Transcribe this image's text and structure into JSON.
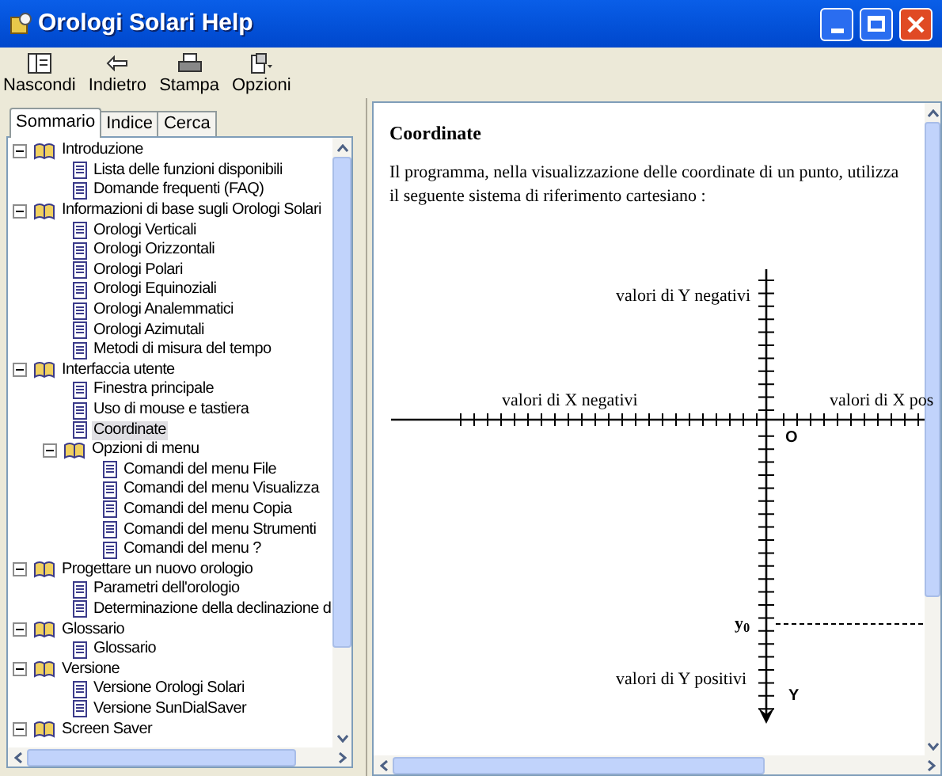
{
  "window": {
    "title": "Orologi Solari Help"
  },
  "toolbar": [
    {
      "label": "Nascondi",
      "kind": "hide"
    },
    {
      "label": "Indietro",
      "kind": "back"
    },
    {
      "label": "Stampa",
      "kind": "print"
    },
    {
      "label": "Opzioni",
      "kind": "options"
    }
  ],
  "tabs": [
    {
      "label": "Sommario",
      "selected": true
    },
    {
      "label": "Indice",
      "selected": false
    },
    {
      "label": "Cerca",
      "selected": false
    }
  ],
  "tree": [
    {
      "label": "Introduzione",
      "kind": "book",
      "expanded": true,
      "selected": false,
      "children": [
        {
          "label": "Lista delle funzioni disponibili",
          "kind": "page",
          "selected": false
        },
        {
          "label": "Domande frequenti (FAQ)",
          "kind": "page",
          "selected": false
        }
      ]
    },
    {
      "label": "Informazioni di base sugli Orologi Solari",
      "kind": "book",
      "expanded": true,
      "selected": false,
      "children": [
        {
          "label": "Orologi Verticali",
          "kind": "page",
          "selected": false
        },
        {
          "label": "Orologi Orizzontali",
          "kind": "page",
          "selected": false
        },
        {
          "label": "Orologi Polari",
          "kind": "page",
          "selected": false
        },
        {
          "label": "Orologi Equinoziali",
          "kind": "page",
          "selected": false
        },
        {
          "label": "Orologi Analemmatici",
          "kind": "page",
          "selected": false
        },
        {
          "label": "Orologi Azimutali",
          "kind": "page",
          "selected": false
        },
        {
          "label": "Metodi di misura del tempo",
          "kind": "page",
          "selected": false
        }
      ]
    },
    {
      "label": "Interfaccia utente",
      "kind": "book",
      "expanded": true,
      "selected": false,
      "children": [
        {
          "label": "Finestra principale",
          "kind": "page",
          "selected": false
        },
        {
          "label": "Uso di mouse e tastiera",
          "kind": "page",
          "selected": false
        },
        {
          "label": "Coordinate",
          "kind": "page",
          "selected": true
        },
        {
          "label": "Opzioni di menu",
          "kind": "book",
          "expanded": true,
          "selected": false,
          "children": [
            {
              "label": "Comandi del menu File",
              "kind": "page",
              "selected": false
            },
            {
              "label": "Comandi del menu Visualizza",
              "kind": "page",
              "selected": false
            },
            {
              "label": "Comandi del menu Copia",
              "kind": "page",
              "selected": false
            },
            {
              "label": "Comandi del menu Strumenti",
              "kind": "page",
              "selected": false
            },
            {
              "label": "Comandi del menu ?",
              "kind": "page",
              "selected": false
            }
          ]
        }
      ]
    },
    {
      "label": "Progettare un nuovo orologio",
      "kind": "book",
      "expanded": true,
      "selected": false,
      "children": [
        {
          "label": "Parametri dell'orologio",
          "kind": "page",
          "selected": false
        },
        {
          "label": "Determinazione della declinazione d",
          "kind": "page",
          "selected": false
        }
      ]
    },
    {
      "label": "Glossario",
      "kind": "book",
      "expanded": true,
      "selected": false,
      "children": [
        {
          "label": "Glossario",
          "kind": "page",
          "selected": false
        }
      ]
    },
    {
      "label": "Versione",
      "kind": "book",
      "expanded": true,
      "selected": false,
      "children": [
        {
          "label": "Versione Orologi Solari",
          "kind": "page",
          "selected": false
        },
        {
          "label": "Versione SunDialSaver",
          "kind": "page",
          "selected": false
        }
      ]
    },
    {
      "label": "Screen Saver",
      "kind": "book",
      "expanded": true,
      "selected": false
    }
  ],
  "topic": {
    "heading": "Coordinate",
    "paragraph": "Il programma, nella visualizzazione delle coordinate di un punto, utilizza il seguente  sistema di riferimento cartesiano :",
    "diagram": {
      "y_negative": "valori di Y negativi",
      "x_negative": "valori di X negativi",
      "x_positive": "valori di X pos",
      "origin": "O",
      "y0": "y$_{0}$",
      "y_positive": "valori di Y positivi",
      "y_axis": "Y"
    }
  }
}
